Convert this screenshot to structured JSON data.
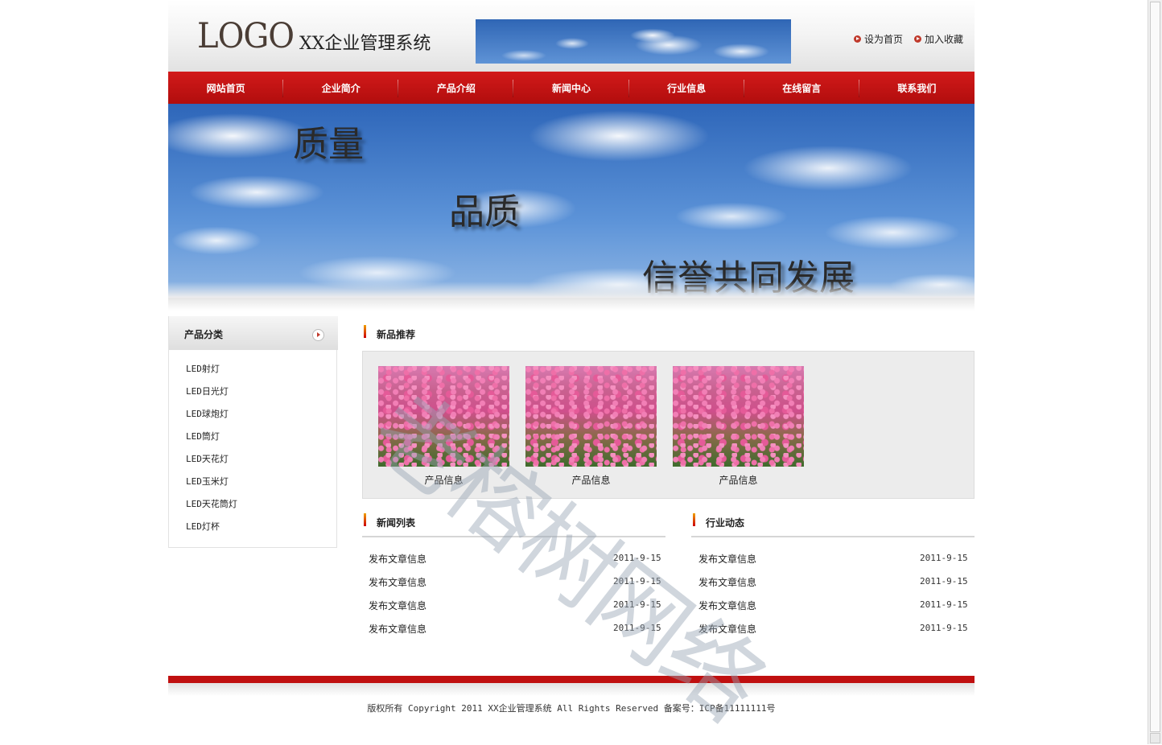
{
  "header": {
    "logo": "LOGO",
    "site_title": "XX企业管理系统",
    "links": [
      {
        "label": "设为首页",
        "icon": "bullet-arrow-icon"
      },
      {
        "label": "加入收藏",
        "icon": "bullet-arrow-icon"
      }
    ]
  },
  "nav": {
    "items": [
      "网站首页",
      "企业简介",
      "产品介绍",
      "新闻中心",
      "行业信息",
      "在线留言",
      "联系我们"
    ]
  },
  "banner": {
    "slogans": [
      "质量",
      "品质",
      "信誉共同发展"
    ]
  },
  "sidebar": {
    "title": "产品分类",
    "items": [
      "LED射灯",
      "LED日光灯",
      "LED球炮灯",
      "LED筒灯",
      "LED天花灯",
      "LED玉米灯",
      "LED天花筒灯",
      "LED灯杯"
    ]
  },
  "products": {
    "title": "新品推荐",
    "items": [
      "产品信息",
      "产品信息",
      "产品信息"
    ]
  },
  "news": {
    "title": "新闻列表",
    "items": [
      {
        "title": "发布文章信息",
        "date": "2011-9-15"
      },
      {
        "title": "发布文章信息",
        "date": "2011-9-15"
      },
      {
        "title": "发布文章信息",
        "date": "2011-9-15"
      },
      {
        "title": "发布文章信息",
        "date": "2011-9-15"
      }
    ]
  },
  "industry": {
    "title": "行业动态",
    "items": [
      {
        "title": "发布文章信息",
        "date": "2011-9-15"
      },
      {
        "title": "发布文章信息",
        "date": "2011-9-15"
      },
      {
        "title": "发布文章信息",
        "date": "2011-9-15"
      },
      {
        "title": "发布文章信息",
        "date": "2011-9-15"
      }
    ]
  },
  "footer": {
    "copyright": "版权所有 Copyright 2011 XX企业管理系统 All Rights Reserved  备案号：ICP备11111111号"
  },
  "watermark": "老榕树网络",
  "colors": {
    "nav_red": "#c81212",
    "footer_red": "#c01010"
  }
}
